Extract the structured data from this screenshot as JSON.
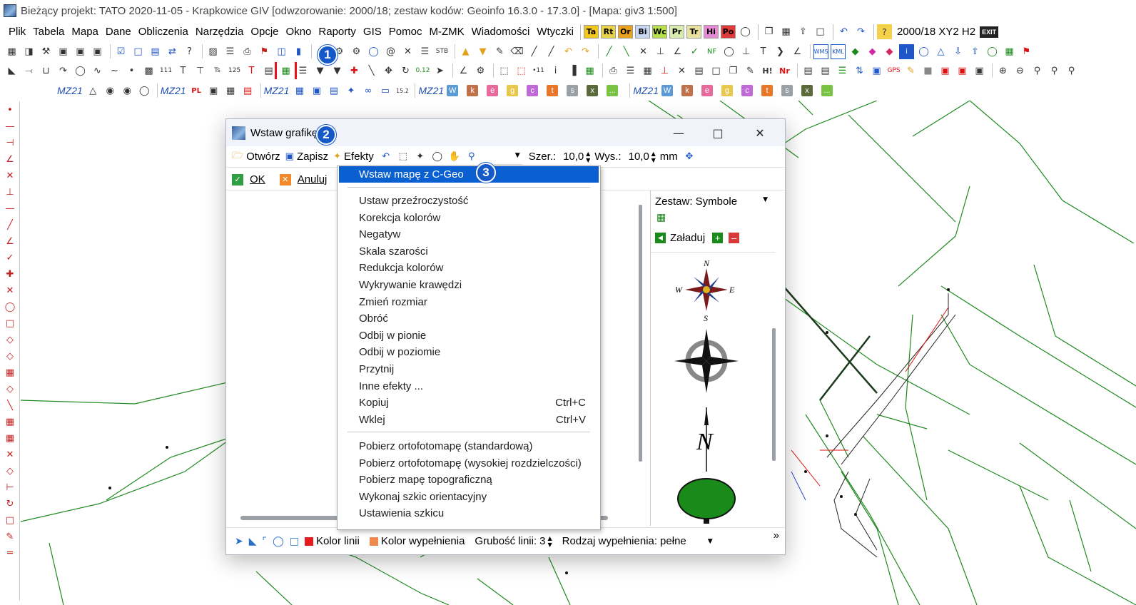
{
  "window": {
    "title": "Bieżący projekt: TATO 2020-11-05 - Krapkowice GIV [odwzorowanie: 2000/18; zestaw kodów: Geoinfo 16.3.0 - 17.3.0] - [Mapa: giv3  1:500]"
  },
  "menubar": {
    "items": [
      "Plik",
      "Tabela",
      "Mapa",
      "Dane",
      "Obliczenia",
      "Narzędzia",
      "Opcje",
      "Okno",
      "Raporty",
      "GIS",
      "Pomoc",
      "M-ZMK",
      "Wiadomości",
      "Wtyczki"
    ],
    "project_tags": [
      {
        "label": "Ta",
        "color": "#f0c81e"
      },
      {
        "label": "Rt",
        "color": "#e8d24a"
      },
      {
        "label": "Or",
        "color": "#e8a21e"
      },
      {
        "label": "Bi",
        "color": "#c8d7f2"
      },
      {
        "label": "Wc",
        "color": "#b7e04a"
      },
      {
        "label": "Pr",
        "color": "#d9ecb0"
      },
      {
        "label": "Tr",
        "color": "#e8e2a0"
      },
      {
        "label": "Hi",
        "color": "#e68ad6"
      },
      {
        "label": "Po",
        "color": "#e23a3a"
      }
    ],
    "coord_system": "2000/18 XY2 H2",
    "exit_label": "EXIT"
  },
  "mz_toolbar": {
    "label": "MZ21",
    "letter_chips": [
      {
        "letter": "W",
        "color": "#5b9bd5"
      },
      {
        "letter": "k",
        "color": "#c0714a"
      },
      {
        "letter": "e",
        "color": "#e86a9a"
      },
      {
        "letter": "g",
        "color": "#e8c84a"
      },
      {
        "letter": "c",
        "color": "#c06ad8"
      },
      {
        "letter": "t",
        "color": "#e8772a"
      },
      {
        "letter": "s",
        "color": "#9aa0a6"
      },
      {
        "letter": "x",
        "color": "#5a6a3a"
      },
      {
        "letter": "...",
        "color": "#7ac242"
      }
    ]
  },
  "dialog": {
    "title": "Wstaw grafikę",
    "toolbar": {
      "open_label": "Otwórz",
      "save_label": "Zapisz",
      "effects_label": "Efekty",
      "width_label": "Szer.:",
      "width_value": "10,0",
      "height_label": "Wys.:",
      "height_value": "10,0",
      "unit": "mm"
    },
    "ok_label": "OK",
    "cancel_label": "Anuluj",
    "panel": {
      "set_label": "Zestaw: Symbole",
      "load_label": "Załaduj",
      "compass_letters": {
        "n": "N",
        "s": "S",
        "e": "E",
        "w": "W"
      }
    },
    "bottom": {
      "line_color_label": "Kolor linii",
      "line_color": "#e51c1c",
      "fill_color_label": "Kolor wypełnienia",
      "fill_color": "#f08a4b",
      "line_width_label": "Grubość linii:",
      "line_width_value": "3",
      "fill_type_label": "Rodzaj wypełnienia:",
      "fill_type_value": "pełne",
      "more": "»"
    }
  },
  "effects_menu": {
    "highlighted": "Wstaw mapę z C-Geo",
    "group1": [
      "Ustaw przeźroczystość",
      "Korekcja kolorów",
      "Negatyw",
      "Skala szarości",
      "Redukcja kolorów",
      "Wykrywanie krawędzi",
      "Zmień rozmiar",
      "Obróć",
      "Odbij w pionie",
      "Odbij w poziomie",
      "Przytnij",
      "Inne efekty ..."
    ],
    "copy_label": "Kopiuj",
    "copy_shortcut": "Ctrl+C",
    "paste_label": "Wklej",
    "paste_shortcut": "Ctrl+V",
    "group2": [
      "Pobierz ortofotomapę (standardową)",
      "Pobierz ortofotomapę (wysokiej rozdzielczości)",
      "Pobierz mapę topograficzną",
      "Wykonaj szkic orientacyjny",
      "Ustawienia szkicu"
    ]
  },
  "step_badges": [
    "1",
    "2",
    "3"
  ],
  "colors": {
    "accent_blue": "#0a5fd1",
    "badge_blue": "#1459c7",
    "highlight_red": "#e8141c",
    "map_line_green": "#1f8a1f"
  }
}
